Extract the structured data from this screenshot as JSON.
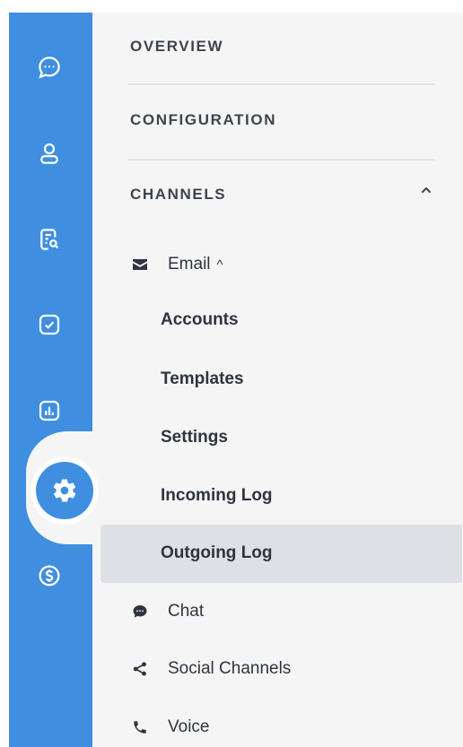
{
  "rail": {
    "icons": [
      "chat-bubble-icon",
      "user-icon",
      "report-search-icon",
      "checkbox-icon",
      "chart-icon",
      "gear-icon",
      "dollar-icon"
    ]
  },
  "menu": {
    "sections": {
      "overview": "OVERVIEW",
      "configuration": "CONFIGURATION",
      "channels": "CHANNELS"
    },
    "email": {
      "label": "Email",
      "caret": "^",
      "items": [
        "Accounts",
        "Templates",
        "Settings",
        "Incoming Log",
        "Outgoing Log"
      ]
    },
    "channels": {
      "chat": "Chat",
      "social": "Social Channels",
      "voice": "Voice"
    }
  },
  "colors": {
    "rail": "#3f8ee0",
    "panel": "#f5f5f5",
    "selected": "#dde1e6",
    "text": "#2e3540"
  }
}
